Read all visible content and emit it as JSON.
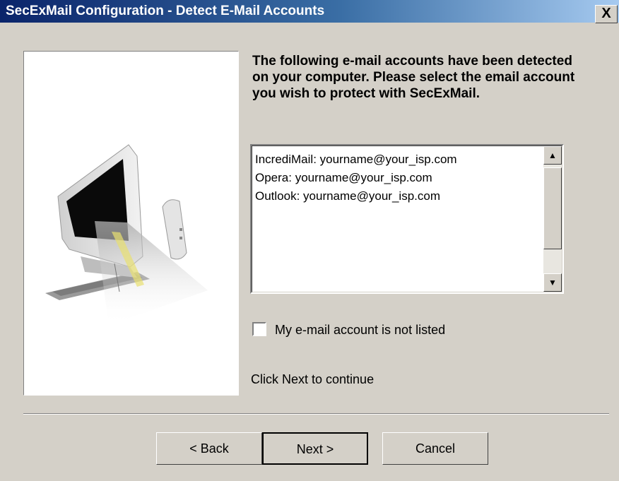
{
  "window": {
    "title": "SecExMail Configuration -  Detect E-Mail Accounts",
    "close_label": "X"
  },
  "instruction": "The following e-mail accounts have been detected on your computer. Please select the email account you wish to protect with SecExMail.",
  "accounts": [
    "IncrediMail: yourname@your_isp.com",
    "Opera: yourname@your_isp.com",
    "Outlook: yourname@your_isp.com"
  ],
  "scroll_up": "▲",
  "scroll_down": "▼",
  "checkbox_label": "My e-mail account is not listed",
  "hint": "Click Next to continue",
  "buttons": {
    "back": "< Back",
    "next": "Next >",
    "cancel": "Cancel"
  }
}
